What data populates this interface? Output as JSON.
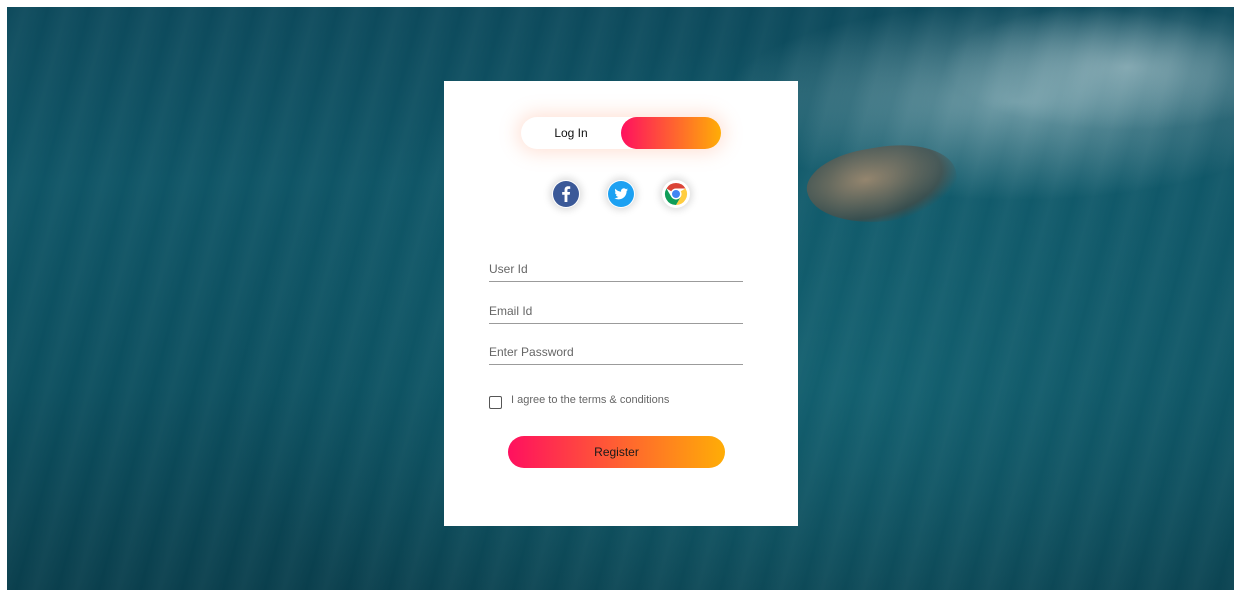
{
  "toggle": {
    "login_label": "Log In",
    "register_label": ""
  },
  "social": [
    {
      "name": "facebook-icon",
      "color": "#3b5998"
    },
    {
      "name": "twitter-icon",
      "color": "#1da1f2"
    },
    {
      "name": "chrome-icon",
      "color": "#db4437"
    }
  ],
  "form": {
    "user_id_placeholder": "User Id",
    "email_placeholder": "Email Id",
    "password_placeholder": "Enter Password",
    "terms_label": "I agree to the terms & conditions",
    "submit_label": "Register"
  },
  "colors": {
    "gradient_start": "#ff105f",
    "gradient_end": "#ffad06"
  }
}
